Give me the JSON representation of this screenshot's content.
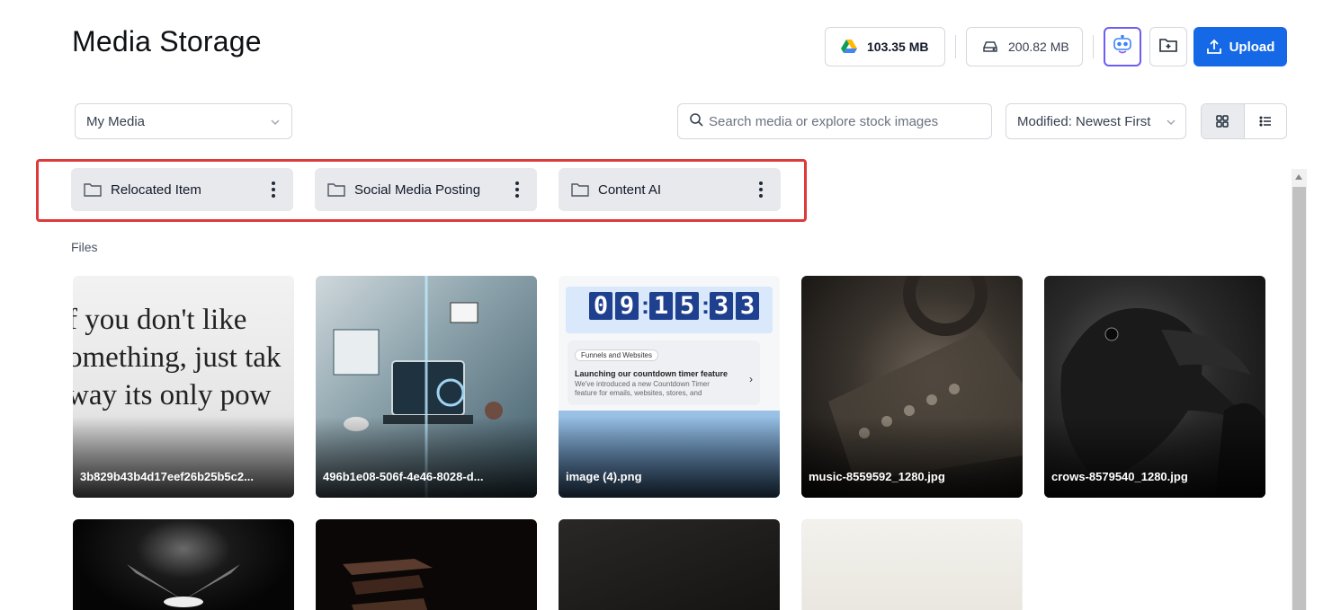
{
  "header": {
    "title": "Media Storage"
  },
  "storage": {
    "drive_usage": "103.35 MB",
    "local_usage": "200.82 MB",
    "drive_icon": "google-drive-icon",
    "local_icon": "hard-drive-icon"
  },
  "actions": {
    "upload_label": "Upload",
    "ai_icon": "ai-robot-icon",
    "new_folder_icon": "folder-plus-icon",
    "upload_icon": "upload-icon"
  },
  "filters": {
    "source_selected": "My Media",
    "search_placeholder": "Search media or explore stock images",
    "sort_selected": "Modified: Newest First",
    "view_mode": "grid"
  },
  "folders": [
    {
      "name": "Relocated Item"
    },
    {
      "name": "Social Media Posting"
    },
    {
      "name": "Content AI"
    }
  ],
  "files_label": "Files",
  "files": [
    {
      "name": "3b829b43b4d17eef26b25b5c2...",
      "preview_text": [
        "f you don't like",
        "omething, just tak",
        "way its only pow"
      ]
    },
    {
      "name": "496b1e08-506f-4e46-8028-d..."
    },
    {
      "name": "image (4).png",
      "timer": [
        "0",
        "9",
        "1",
        "5",
        "3",
        "3"
      ],
      "tag": "Funnels and Websites",
      "headline": "Launching our countdown timer feature",
      "body": "We've introduced a new Countdown Timer feature for emails, websites, stores, and"
    },
    {
      "name": "music-8559592_1280.jpg"
    },
    {
      "name": "crows-8579540_1280.jpg"
    },
    {
      "name": ""
    },
    {
      "name": ""
    },
    {
      "name": ""
    },
    {
      "name": ""
    }
  ],
  "colors": {
    "accent": "#1569e6",
    "highlight": "#de3a3a",
    "ai_border": "#6d5cf5"
  }
}
